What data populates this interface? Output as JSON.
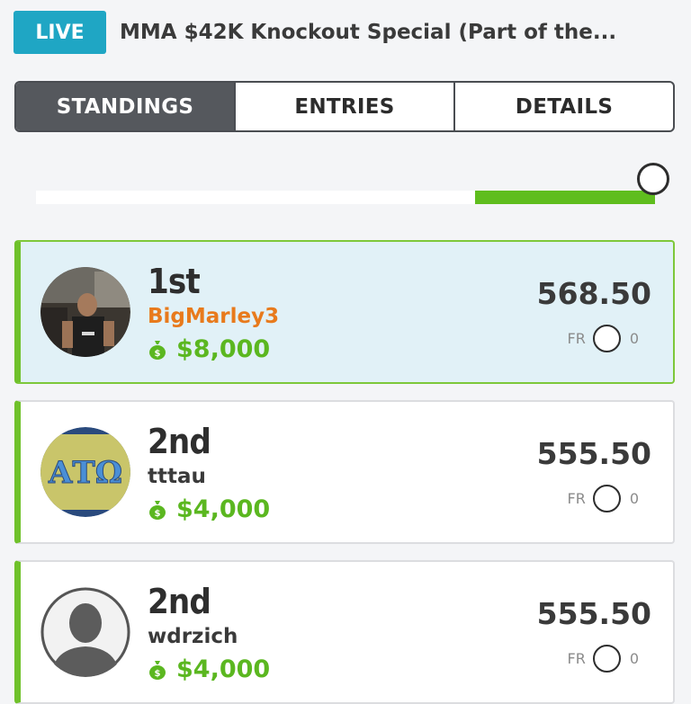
{
  "header": {
    "live_label": "LIVE",
    "contest_title": "MMA $42K Knockout Special (Part of the..."
  },
  "tabs": [
    {
      "label": "STANDINGS",
      "active": true
    },
    {
      "label": "ENTRIES",
      "active": false
    },
    {
      "label": "DETAILS",
      "active": false
    }
  ],
  "progress": {
    "fraction_complete": 0.29,
    "fill_color": "#5fbd1e"
  },
  "entries": [
    {
      "rank": "1st",
      "username": "BigMarley3",
      "prize": "$8,000",
      "score": "568.50",
      "fr_label": "FR",
      "fr_count": "0",
      "avatar": "photo-avatar"
    },
    {
      "rank": "2nd",
      "username": "tttau",
      "prize": "$4,000",
      "score": "555.50",
      "fr_label": "FR",
      "fr_count": "0",
      "avatar": "greek-letters-avatar",
      "avatar_text": "ΑΤΩ"
    },
    {
      "rank": "2nd",
      "username": "wdrzich",
      "prize": "$4,000",
      "score": "555.50",
      "fr_label": "FR",
      "fr_count": "0",
      "avatar": "default-user-avatar"
    }
  ],
  "colors": {
    "accent_green": "#6fc12a",
    "live_blue": "#1fa6c4",
    "highlight_orange": "#e87a1c"
  }
}
